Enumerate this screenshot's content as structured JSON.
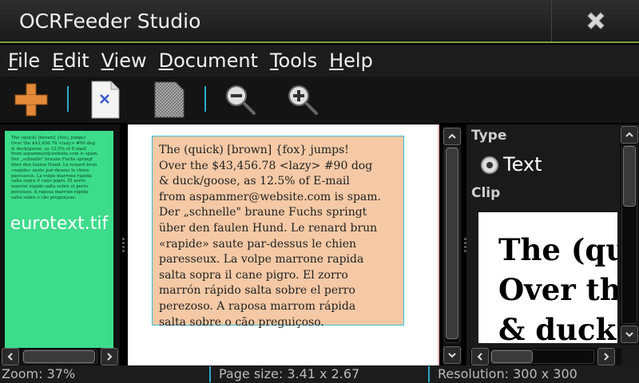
{
  "window": {
    "title": "OCRFeeder Studio"
  },
  "menu": [
    {
      "key": "F",
      "rest": "ile"
    },
    {
      "key": "E",
      "rest": "dit"
    },
    {
      "key": "V",
      "rest": "iew"
    },
    {
      "key": "D",
      "rest": "ocument"
    },
    {
      "key": "T",
      "rest": "ools"
    },
    {
      "key": "H",
      "rest": "elp"
    }
  ],
  "toolbar": {
    "icons": [
      "add-icon",
      "remove-page-icon",
      "page-image-icon",
      "zoom-out-icon",
      "zoom-in-icon"
    ]
  },
  "thumbnail": {
    "label": "eurotext.tif",
    "preview_text": "The (quick) [brown] {fox} jumps!\nOver the $43,456.78 <lazy> #90 dog\n& duck/goose, as 12.5% of E-mail\nfrom aspammer@website.com is spam.\nDer „schnelle\" braune Fuchs springt\nüber den faulen Hund. Le renard brun\n«rapide» saute par-dessus le chien\nparesseux. La volpe marrone rapida\nsalta sopra il cane pigro. El zorro\nmarrón rápido salta sobre el perro\nperezoso. A raposa marrom rápida\nsalta sobre o cão preguiçoso."
  },
  "document": {
    "text": "The (quick) [brown] {fox} jumps!\nOver the $43,456.78 <lazy> #90 dog\n& duck/goose, as 12.5% of E-mail\nfrom aspammer@website.com is spam.\nDer „schnelle\" braune Fuchs springt\nüber den faulen Hund. Le renard brun\n«rapide» saute par-dessus le chien\nparesseux. La volpe marrone rapida\nsalta sopra il cane pigro. El zorro\nmarrón rápido salta sobre el perro\nperezoso. A raposa marrom rápida\nsalta sobre o cão preguiçoso."
  },
  "properties": {
    "type_label": "Type",
    "type_value": "Text",
    "clip_label": "Clip",
    "clip_text": "The (qu\nOver th\n& duck"
  },
  "status": {
    "zoom": "Zoom: 37%",
    "page_size": "Page size: 3.41 x 2.67",
    "resolution": "Resolution: 300 x 300"
  },
  "colors": {
    "accent": "#7aa43a",
    "separator": "#2aa9c8",
    "thumbnail_bg": "#3ddc8a",
    "text_box": "#f5c9a5"
  }
}
